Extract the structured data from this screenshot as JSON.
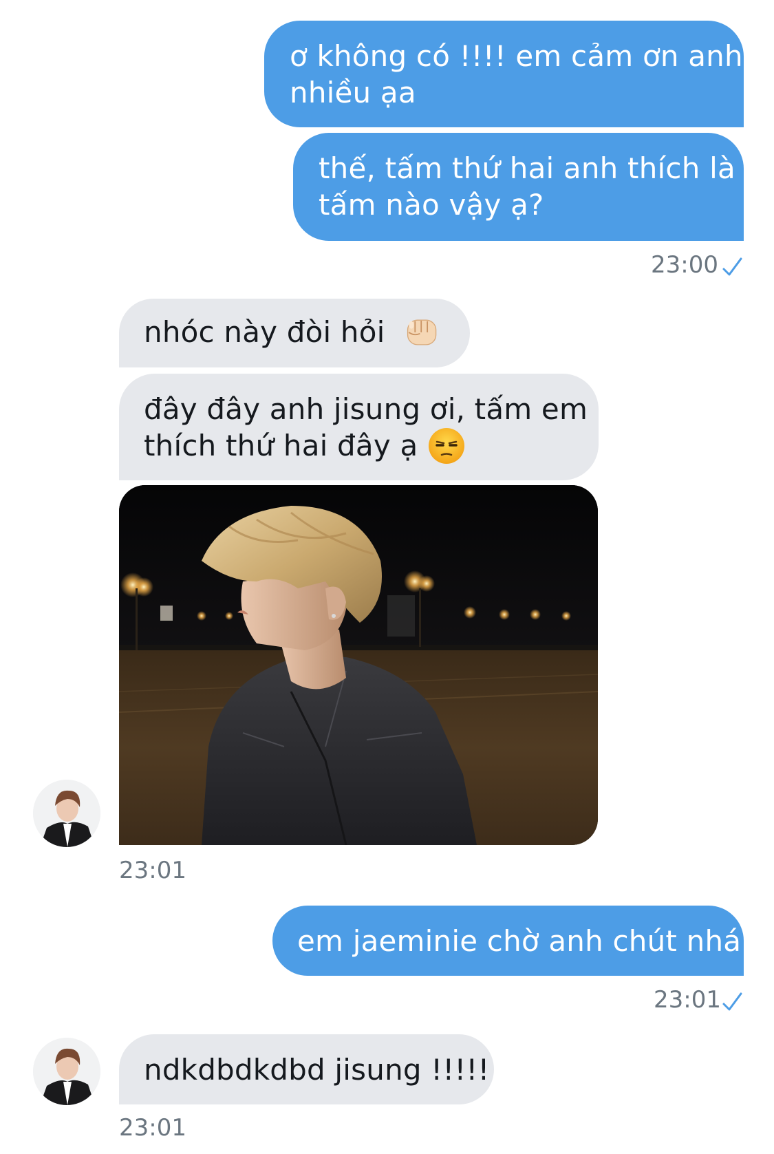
{
  "messages": {
    "m1": {
      "line1": "ơ không có !!!! em cảm ơn anh",
      "line2": "nhiều ạa"
    },
    "m2": {
      "line1": "thế, tấm thứ hai anh thích là",
      "line2": "tấm nào vậy ạ?"
    },
    "m3": {
      "text": "nhóc này đòi hỏi",
      "emoji": "fist-emoji"
    },
    "m4": {
      "line1": "đây đây anh jisung ơi, tấm em",
      "line2": "thích thứ hai đây ạ",
      "emoji": "unamused-face-emoji"
    },
    "m5": {
      "description_icon": "photo"
    },
    "m6": {
      "text": "em jaeminie chờ anh chút nhá"
    },
    "m7": {
      "text": "ndkdbdkdbd jisung !!!!!"
    }
  },
  "timestamps": {
    "t1": "23:00",
    "t2": "23:01",
    "t3": "23:01",
    "t4": "23:01"
  },
  "icons": {
    "read_check": "check-icon",
    "avatar": "avatar"
  },
  "colors": {
    "outgoing_bubble": "#4d9de6",
    "incoming_bubble": "#e6e8ec",
    "timestamp": "#6b7680",
    "check": "#4d9de6"
  }
}
